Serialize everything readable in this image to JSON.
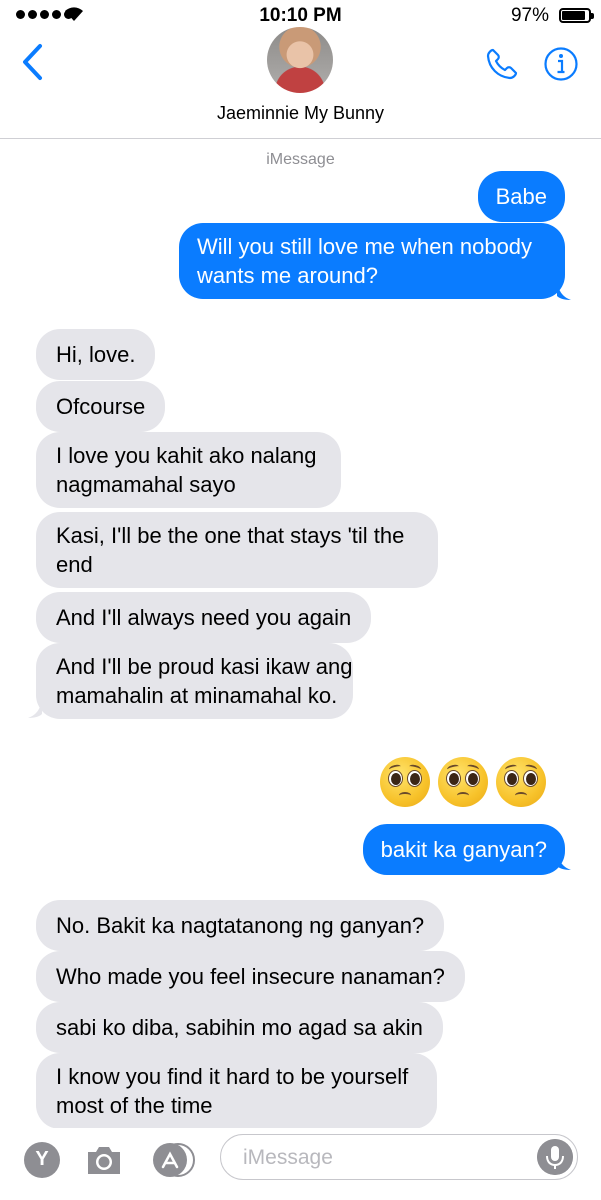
{
  "status": {
    "time": "10:10 PM",
    "battery_percent": "97%",
    "battery_level": 0.97
  },
  "header": {
    "contact_name": "Jaeminnie My Bunny",
    "service": "iMessage"
  },
  "colors": {
    "accent": "#0a7cff",
    "incoming": "#e5e5ea",
    "meta": "#8e8e93"
  },
  "messages": [
    {
      "dir": "out",
      "text": "Babe"
    },
    {
      "dir": "out",
      "text": "Will you still love me when nobody",
      "text2": "wants me around?"
    },
    {
      "dir": "in",
      "text": "Hi, love."
    },
    {
      "dir": "in",
      "text": "Ofcourse"
    },
    {
      "dir": "in",
      "text": "I love you kahit ako nalang",
      "text2": "nagmamahal sayo"
    },
    {
      "dir": "in",
      "text": "Kasi, I'll be the one that stays 'til the",
      "text2": "end"
    },
    {
      "dir": "in",
      "text": "And I'll always need you again"
    },
    {
      "dir": "in",
      "text": "And I'll be proud kasi ikaw ang",
      "text2": "mamahalin at minamahal ko."
    },
    {
      "dir": "out",
      "emoji": "pleading-face x3"
    },
    {
      "dir": "out",
      "text": "bakit ka ganyan?"
    },
    {
      "dir": "in",
      "text": "No. Bakit ka nagtatanong ng ganyan?"
    },
    {
      "dir": "in",
      "text": "Who made you feel insecure nanaman?"
    },
    {
      "dir": "in",
      "text": "sabi ko diba, sabihin mo agad sa akin"
    },
    {
      "dir": "in",
      "text": "I know you find it hard to be yourself",
      "text2": "most of the time"
    }
  ],
  "input": {
    "placeholder": "iMessage",
    "app_badge": "Y"
  },
  "icons": [
    "back-chevron-icon",
    "phone-icon",
    "info-icon",
    "camera-icon",
    "app-store-icon",
    "microphone-icon"
  ]
}
